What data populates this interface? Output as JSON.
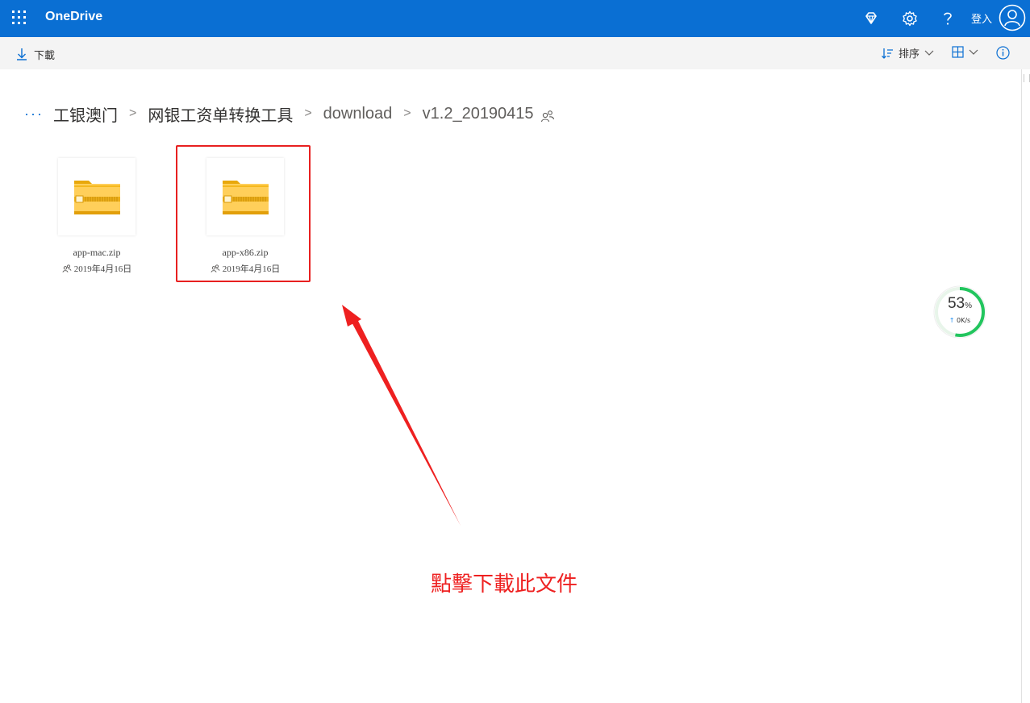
{
  "header": {
    "app_name": "OneDrive",
    "sign_in_label": "登入",
    "icons": [
      "app-launcher-icon",
      "premium-diamond-icon",
      "settings-gear-icon",
      "help-icon",
      "account-avatar-icon"
    ],
    "brand_color": "#0a6fd3"
  },
  "commandbar": {
    "download_label": "下載",
    "sort_label": "排序"
  },
  "breadcrumb": {
    "ellipsis": "···",
    "items": [
      "工银澳门",
      "网银工资单转换工具",
      "download",
      "v1.2_20190415"
    ]
  },
  "files": [
    {
      "name": "app-mac.zip",
      "date": "2019年4月16日"
    },
    {
      "name": "app-x86.zip",
      "date": "2019年4月16日"
    }
  ],
  "annotation": {
    "text": "點擊下載此文件",
    "color": "#ee2020"
  },
  "speed_widget": {
    "percent": "53",
    "percent_unit": "%",
    "rate": "0K/s",
    "progress": 0.53,
    "ring_color": "#22c55e"
  }
}
